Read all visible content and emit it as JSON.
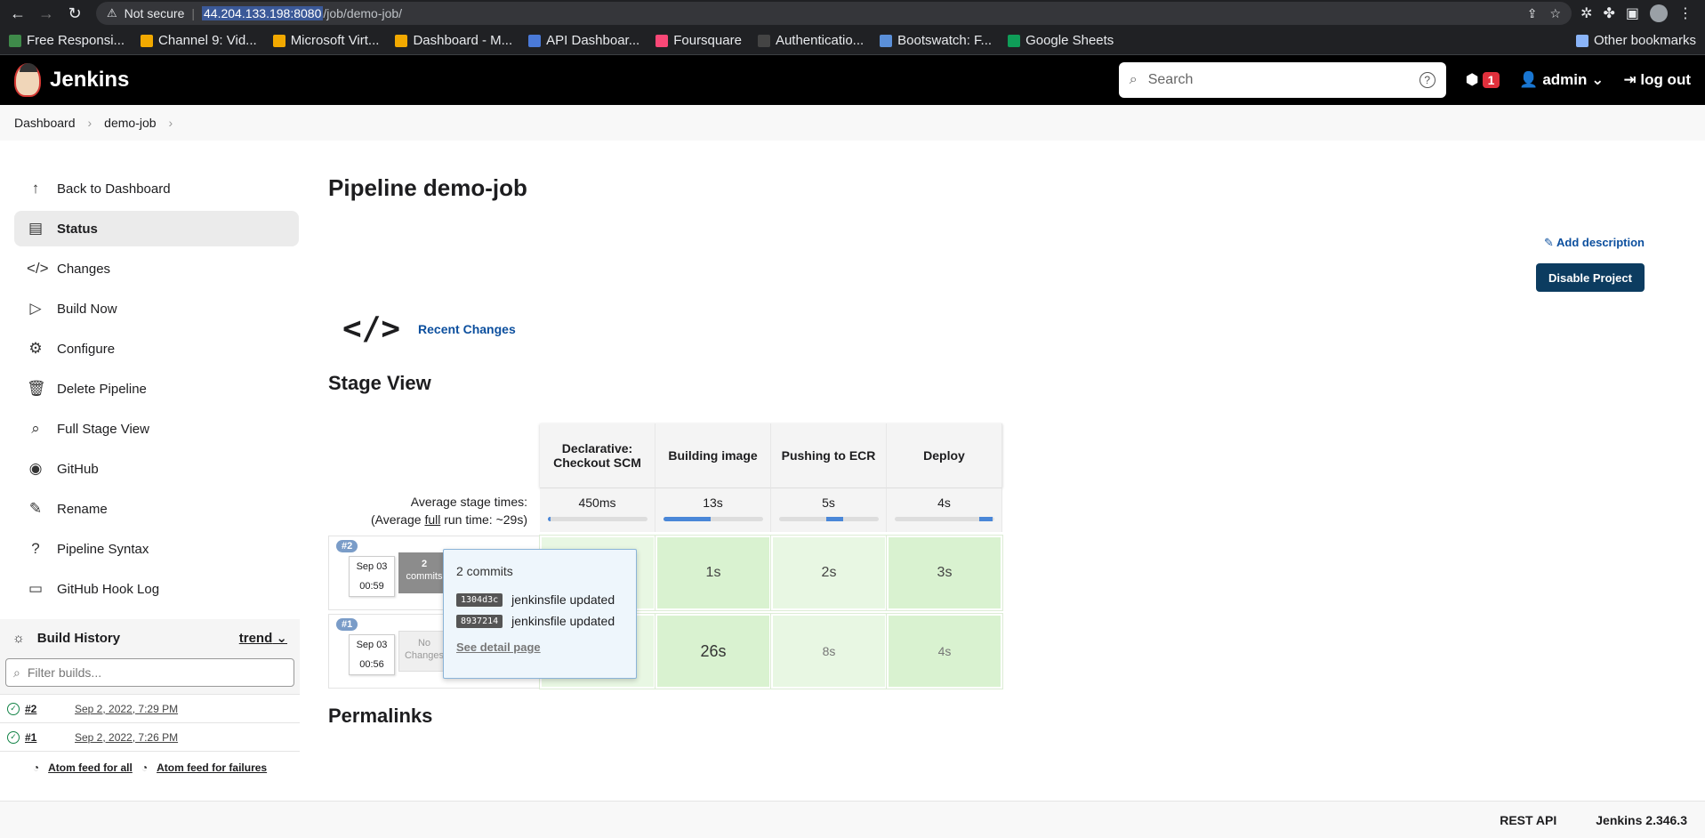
{
  "browser": {
    "security": "Not secure",
    "url_host": "44.204.133.198:8080",
    "url_path": "/job/demo-job/",
    "bookmarks": [
      {
        "label": "Free Responsi...",
        "color": "#3f8a4a"
      },
      {
        "label": "Channel 9: Vid...",
        "color": "#f2a900"
      },
      {
        "label": "Microsoft Virt...",
        "color": "#f2a900"
      },
      {
        "label": "Dashboard - M...",
        "color": "#f2a900"
      },
      {
        "label": "API Dashboar...",
        "color": "#4a7ad8"
      },
      {
        "label": "Foursquare",
        "color": "#f94877"
      },
      {
        "label": "Authenticatio...",
        "color": "#444444"
      },
      {
        "label": "Bootswatch: F...",
        "color": "#5a8fd8"
      },
      {
        "label": "Google Sheets",
        "color": "#0f9d58"
      }
    ],
    "other_bookmarks": "Other bookmarks"
  },
  "header": {
    "brand": "Jenkins",
    "search_placeholder": "Search",
    "alert_count": "1",
    "user": "admin",
    "logout": "log out"
  },
  "breadcrumb": [
    "Dashboard",
    "demo-job"
  ],
  "sidebar": {
    "items": [
      {
        "label": "Back to Dashboard",
        "icon": "↑",
        "name": "sidebar-item-back-to-dashboard"
      },
      {
        "label": "Status",
        "icon": "▤",
        "name": "sidebar-item-status"
      },
      {
        "label": "Changes",
        "icon": "</>",
        "name": "sidebar-item-changes"
      },
      {
        "label": "Build Now",
        "icon": "▷",
        "name": "sidebar-item-build-now"
      },
      {
        "label": "Configure",
        "icon": "⚙",
        "name": "sidebar-item-configure"
      },
      {
        "label": "Delete Pipeline",
        "icon": "🗑",
        "name": "sidebar-item-delete-pipeline"
      },
      {
        "label": "Full Stage View",
        "icon": "⌕",
        "name": "sidebar-item-full-stage-view"
      },
      {
        "label": "GitHub",
        "icon": "◉",
        "name": "sidebar-item-github"
      },
      {
        "label": "Rename",
        "icon": "✎",
        "name": "sidebar-item-rename"
      },
      {
        "label": "Pipeline Syntax",
        "icon": "?",
        "name": "sidebar-item-pipeline-syntax"
      },
      {
        "label": "GitHub Hook Log",
        "icon": "▭",
        "name": "sidebar-item-github-hook-log"
      }
    ]
  },
  "build_history": {
    "title": "Build History",
    "trend": "trend",
    "filter_placeholder": "Filter builds...",
    "builds": [
      {
        "num": "#2",
        "date": "Sep 2, 2022, 7:29 PM"
      },
      {
        "num": "#1",
        "date": "Sep 2, 2022, 7:26 PM"
      }
    ],
    "feed_all": "Atom feed for all",
    "feed_failures": "Atom feed for failures"
  },
  "page": {
    "title": "Pipeline demo-job",
    "add_description": "Add description",
    "disable_project": "Disable Project",
    "recent_changes": "Recent Changes",
    "stage_view_title": "Stage View",
    "permalinks_title": "Permalinks"
  },
  "stage_view": {
    "stages": [
      "Declarative: Checkout SCM",
      "Building image",
      "Pushing to ECR",
      "Deploy"
    ],
    "avg_label_1": "Average stage times:",
    "avg_label_2a": "(Average ",
    "avg_label_2b": "full",
    "avg_label_2c": " run time: ~29s)",
    "avg_times": [
      {
        "label": "450ms",
        "bar_start": 0,
        "bar_fraction": 0.03
      },
      {
        "label": "13s",
        "bar_start": 0,
        "bar_fraction": 0.48
      },
      {
        "label": "5s",
        "bar_start": 0.48,
        "bar_fraction": 0.17
      },
      {
        "label": "4s",
        "bar_start": 0.85,
        "bar_fraction": 0.14
      }
    ],
    "builds": [
      {
        "num": "#2",
        "date": "Sep 03",
        "time": "00:59",
        "changes_count": "2",
        "changes_label": "commits",
        "cells": [
          "",
          "1s",
          "2s",
          "3s"
        ]
      },
      {
        "num": "#1",
        "date": "Sep 03",
        "time": "00:56",
        "changes_count": "No",
        "changes_label": "Changes",
        "cells": [
          "",
          "26s",
          "8s",
          "4s"
        ]
      }
    ],
    "tooltip": {
      "heading": "2 commits",
      "commits": [
        {
          "sha": "1304d3c",
          "msg": "jenkinsfile updated"
        },
        {
          "sha": "8937214",
          "msg": "jenkinsfile updated"
        }
      ],
      "detail_link": "See detail page"
    }
  },
  "footer": {
    "rest_api": "REST API",
    "version": "Jenkins 2.346.3"
  }
}
